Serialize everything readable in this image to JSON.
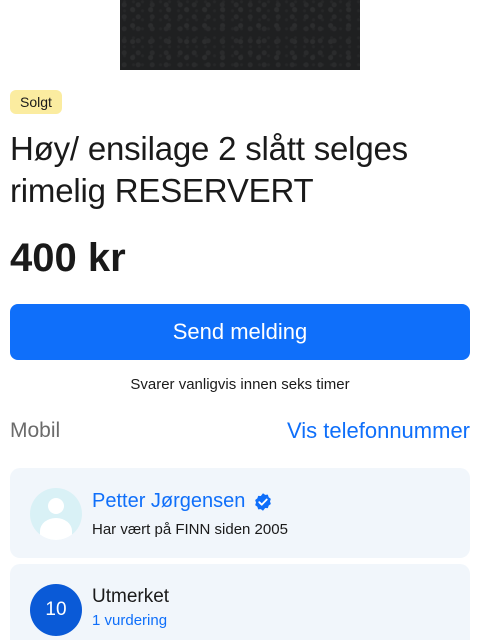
{
  "listing": {
    "status_badge": "Solgt",
    "title": "Høy/ ensilage 2 slått selges rimelig RESERVERT",
    "price": "400 kr"
  },
  "actions": {
    "send_message_label": "Send melding",
    "response_note": "Svarer vanligvis innen seks timer"
  },
  "contact": {
    "label": "Mobil",
    "show_number_label": "Vis telefonnummer"
  },
  "seller": {
    "name": "Petter Jørgensen",
    "since": "Har vært på FINN siden 2005",
    "verified_icon": "verified-badge-icon"
  },
  "rating": {
    "score": "10",
    "title": "Utmerket",
    "count": "1 vurdering"
  },
  "colors": {
    "accent": "#0f6ffa",
    "badge_bg": "#fbeca0",
    "card_bg": "#f1f6fb",
    "rating_circle": "#0a5ad7"
  }
}
